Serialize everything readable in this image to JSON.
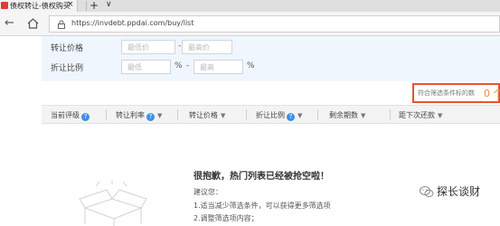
{
  "browser": {
    "tab_title": "债权转让-债权购买",
    "tab_close": "×",
    "new_tab": "+",
    "tab_dropdown": "∨",
    "url": "https://invdebt.ppdai.com/buy/list"
  },
  "filters": {
    "price_label": "转让价格",
    "price_min_placeholder": "最低价",
    "price_max_placeholder": "最高价",
    "range_sep": "-",
    "ratio_label": "折让比例",
    "ratio_min_placeholder": "最低",
    "ratio_max_placeholder": "最高",
    "percent_unit": "%"
  },
  "result": {
    "text": "符合筛选条件标的数",
    "count": "0 个"
  },
  "table": {
    "columns": [
      {
        "label": "当前评级",
        "help": true
      },
      {
        "label": "转让利率",
        "help": true
      },
      {
        "label": "转让价格",
        "help": false
      },
      {
        "label": "折让比例",
        "help": true
      },
      {
        "label": "剩余期数",
        "help": false
      },
      {
        "label": "距下次还款",
        "help": false
      }
    ],
    "help_glyph": "?",
    "sort_glyph": "▼"
  },
  "empty_state": {
    "title": "很抱歉，热门列表已经被抢空啦！",
    "suggest_label": "建议您：",
    "tips": [
      "1.适当减少筛选条件，可以获得更多筛选项",
      "2.调整筛选项内容；"
    ]
  },
  "watermark": {
    "text": "探长谈财"
  }
}
